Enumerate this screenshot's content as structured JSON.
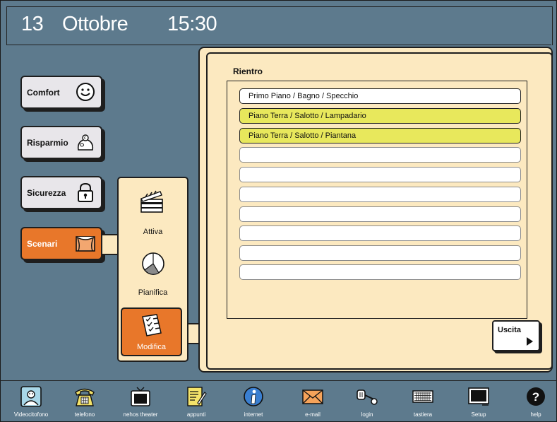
{
  "header": {
    "day": "13",
    "month": "Ottobre",
    "time": "15:30"
  },
  "sidebar": {
    "items": [
      {
        "label": "Comfort",
        "icon": "smiley-icon",
        "active": false
      },
      {
        "label": "Risparmio",
        "icon": "piggy-bank-icon",
        "active": false
      },
      {
        "label": "Sicurezza",
        "icon": "padlock-icon",
        "active": false
      },
      {
        "label": "Scenari",
        "icon": "theater-curtain-icon",
        "active": true
      }
    ]
  },
  "submenu": {
    "items": [
      {
        "label": "Attiva",
        "icon": "clapperboard-icon",
        "active": false
      },
      {
        "label": "Pianifica",
        "icon": "clock-icon",
        "active": false
      },
      {
        "label": "Modifica",
        "icon": "checklist-icon",
        "active": true
      }
    ]
  },
  "panel": {
    "title": "Rientro",
    "rows": [
      {
        "text": "Primo Piano / Bagno / Specchio",
        "selected": false
      },
      {
        "text": "Piano Terra / Salotto / Lampadario",
        "selected": true
      },
      {
        "text": "Piano Terra / Salotto / Piantana",
        "selected": true
      },
      {
        "text": "",
        "selected": false
      },
      {
        "text": "",
        "selected": false
      },
      {
        "text": "",
        "selected": false
      },
      {
        "text": "",
        "selected": false
      },
      {
        "text": "",
        "selected": false
      },
      {
        "text": "",
        "selected": false
      },
      {
        "text": "",
        "selected": false
      }
    ],
    "exit_label": "Uscita"
  },
  "dock": {
    "items": [
      {
        "label": "Videocitofono",
        "icon": "videointercom-icon"
      },
      {
        "label": "telefono",
        "icon": "telephone-icon"
      },
      {
        "label": "nehos theater",
        "icon": "tv-icon"
      },
      {
        "label": "appunti",
        "icon": "notepad-icon"
      },
      {
        "label": "internet",
        "icon": "globe-icon"
      },
      {
        "label": "e-mail",
        "icon": "envelope-icon"
      },
      {
        "label": "login",
        "icon": "key-icon"
      },
      {
        "label": "tastiera",
        "icon": "keyboard-icon"
      },
      {
        "label": "Setup",
        "icon": "monitor-icon"
      },
      {
        "label": "help",
        "icon": "help-icon"
      }
    ]
  },
  "colors": {
    "background": "#5d7a8d",
    "panel": "#fce9c0",
    "accent": "#e8772a",
    "selected_row": "#e8e85c"
  }
}
